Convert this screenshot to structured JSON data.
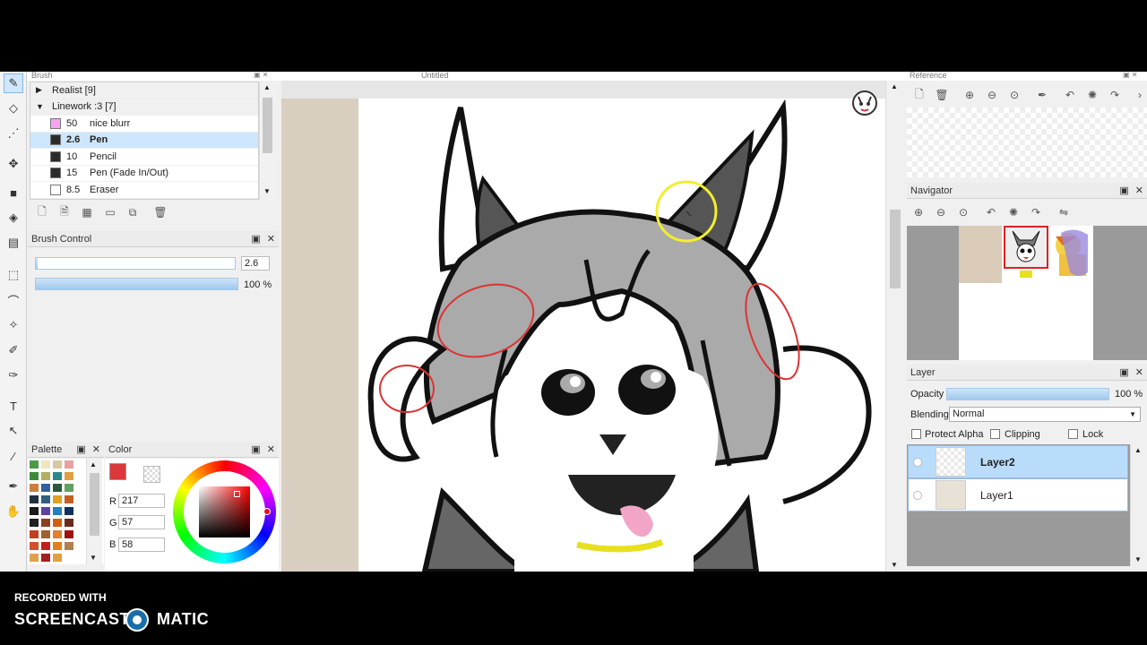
{
  "window": {
    "brush_title": "Brush",
    "canvas_title": "Untitled",
    "reference_title": "Reference"
  },
  "toolbar": {
    "tools": [
      "pen-icon",
      "eraser-icon",
      "lasso-icon",
      "move-icon",
      "fill-rect-icon",
      "bucket-icon",
      "gradient-icon",
      "select-rect-icon",
      "select-lasso-icon",
      "magic-wand-icon",
      "eyedropper-select-icon",
      "bucket-select-icon",
      "text-icon",
      "operation-icon",
      "divider-icon",
      "eyedropper-icon",
      "hand-icon"
    ]
  },
  "brush": {
    "groups": [
      {
        "label": "Realist [9]",
        "arrow": "▶"
      },
      {
        "label": "Linework :3 [7]",
        "arrow": "▼"
      }
    ],
    "items": [
      {
        "size": "50",
        "name": "nice blurr",
        "color": "#f5a3f0"
      },
      {
        "size": "2.6",
        "name": "Pen",
        "color": "#2b2b2b",
        "selected": true
      },
      {
        "size": "10",
        "name": "Pencil",
        "color": "#2b2b2b"
      },
      {
        "size": "15",
        "name": "Pen (Fade In/Out)",
        "color": "#2b2b2b"
      },
      {
        "size": "8.5",
        "name": "Eraser",
        "color": "#ffffff"
      }
    ]
  },
  "brush_control": {
    "title": "Brush Control",
    "size_value": "2.6",
    "size_fraction": 0.01,
    "opacity_value": "100 %",
    "opacity_fraction": 1.0
  },
  "palette": {
    "title": "Palette",
    "colors": [
      "#4a9a4a",
      "#f3e4c0",
      "#d9c8a0",
      "#e8a0a0",
      "#3a8a3a",
      "#b0b060",
      "#2a8a8a",
      "#e0a040",
      "#c88040",
      "#3060a0",
      "#2a5a3a",
      "#60a060",
      "#203040",
      "#306080",
      "#e0a020",
      "#c06020",
      "#1a1a1a",
      "#6040a0",
      "#2080c0",
      "#103060",
      "#202020",
      "#8a4020",
      "#d06010",
      "#6a2a1a",
      "#c04020",
      "#a06030",
      "#e08030",
      "#a01010",
      "#d05030",
      "#c02020",
      "#e08020",
      "#b08050",
      "#e0a050",
      "#a02020",
      "#e0a040"
    ]
  },
  "color": {
    "title": "Color",
    "r": "217",
    "g": "57",
    "b": "58",
    "current": "#d9393a",
    "r_label": "R",
    "g_label": "G",
    "b_label": "B"
  },
  "navigator": {
    "title": "Navigator"
  },
  "layer": {
    "title": "Layer",
    "opacity_label": "Opacity",
    "opacity_value": "100 %",
    "opacity_fraction": 1.0,
    "blending_label": "Blending",
    "blending_value": "Normal",
    "protect_alpha": "Protect Alpha",
    "clipping": "Clipping",
    "lock": "Lock",
    "layers": [
      {
        "name": "Layer2",
        "selected": true
      },
      {
        "name": "Layer1",
        "selected": false
      }
    ]
  },
  "watermark": {
    "line1": "RECORDED WITH",
    "line2_a": "SCREENCAST",
    "line2_b": "MATIC"
  }
}
